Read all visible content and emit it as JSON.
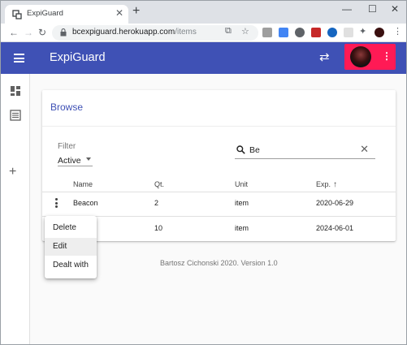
{
  "browser": {
    "tab_title": "ExpiGuard",
    "tab_close": "✕",
    "new_tab": "+",
    "window_controls": [
      "—",
      "☐",
      "✕"
    ],
    "url_host": "bcexpiguard.herokuapp.com",
    "url_path": "/items"
  },
  "appbar": {
    "title": "ExpiGuard",
    "accent": "#3f51b5",
    "user_button_color": "#ff1a55"
  },
  "card": {
    "title": "Browse",
    "filter": {
      "label": "Filter",
      "value": "Active"
    },
    "search": {
      "value": "Be"
    },
    "columns": [
      "Name",
      "Qt.",
      "Unit",
      "Exp."
    ],
    "rows": [
      {
        "name": "Beacon",
        "qty": "2",
        "unit": "item",
        "exp": "2020-06-29"
      },
      {
        "name": "",
        "qty": "10",
        "unit": "item",
        "exp": "2024-06-01"
      }
    ]
  },
  "row_menu": {
    "items": [
      "Delete",
      "Edit",
      "Dealt with"
    ]
  },
  "footer": "Bartosz Cichonski 2020. Version 1.0"
}
